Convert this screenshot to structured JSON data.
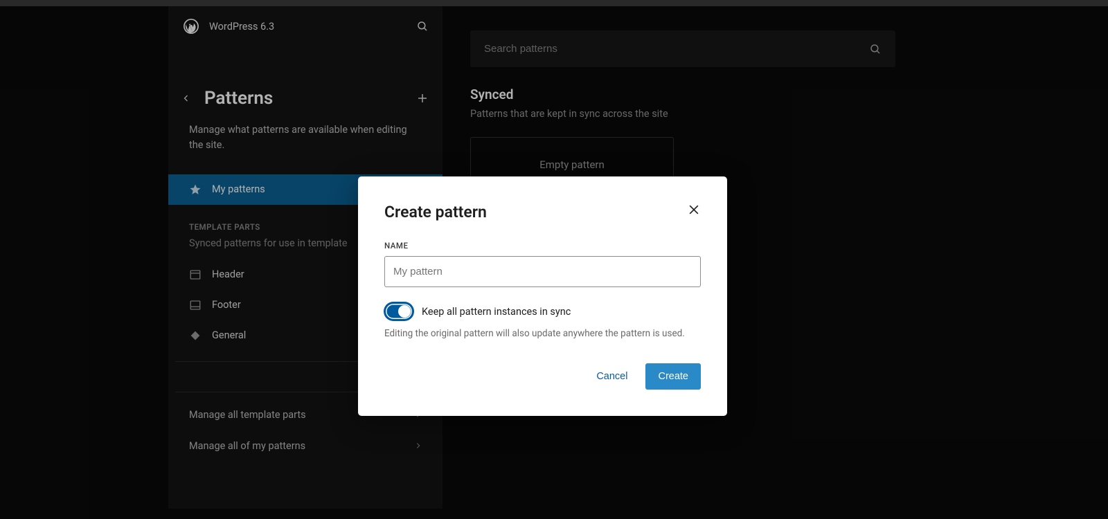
{
  "header": {
    "site_title": "WordPress 6.3"
  },
  "sidebar": {
    "heading": "Patterns",
    "description": "Manage what patterns are available when editing the site.",
    "my_patterns_label": "My patterns",
    "template_parts_label": "TEMPLATE PARTS",
    "template_parts_desc": "Synced patterns for use in template ",
    "items": {
      "header": "Header",
      "footer": "Footer",
      "general": "General"
    },
    "footer_links": {
      "manage_template_parts": "Manage all template parts",
      "manage_my_patterns": "Manage all of my patterns"
    }
  },
  "main": {
    "search_placeholder": "Search patterns",
    "section_title": "Synced",
    "section_desc": "Patterns that are kept in sync across the site",
    "empty_card": "Empty pattern"
  },
  "modal": {
    "title": "Create pattern",
    "name_label": "NAME",
    "name_placeholder": "My pattern",
    "toggle_label": "Keep all pattern instances in sync",
    "toggle_help": "Editing the original pattern will also update anywhere the pattern is used.",
    "cancel": "Cancel",
    "create": "Create",
    "toggle_on": true
  }
}
